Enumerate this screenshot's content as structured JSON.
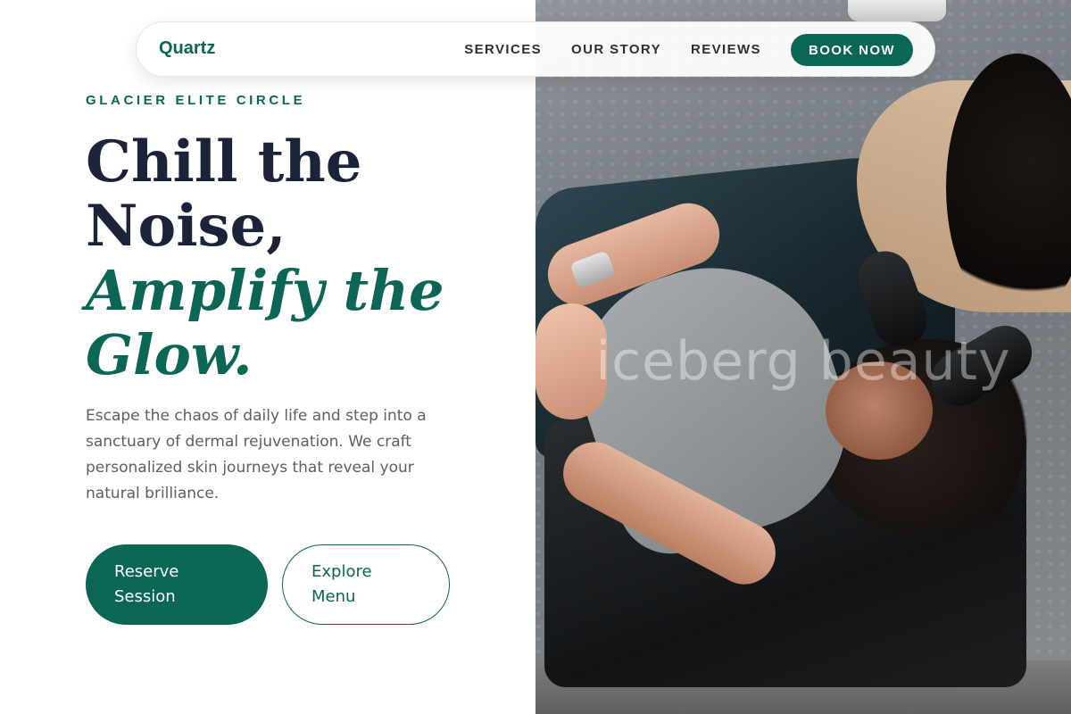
{
  "colors": {
    "brand": "#0b6655",
    "heading": "#1b2338",
    "body_text": "#5a6068"
  },
  "nav": {
    "brand": "Quartz",
    "links": [
      "SERVICES",
      "OUR STORY",
      "REVIEWS"
    ],
    "cta": "BOOK NOW"
  },
  "hero": {
    "eyebrow": "GLACIER ELITE CIRCLE",
    "headline": {
      "line1": "Chill the",
      "line2": "Noise,",
      "line3": "Amplify the",
      "line4": "Glow."
    },
    "description": "Escape the chaos of daily life and step into a sanctuary of dermal rejuvenation. We craft personalized skin journeys that reveal your natural brilliance.",
    "primary_button": {
      "line1": "Reserve",
      "line2": "Session"
    },
    "secondary_button": {
      "line1": "Explore",
      "line2": "Menu"
    }
  },
  "image": {
    "watermark": "iceberg beauty"
  }
}
